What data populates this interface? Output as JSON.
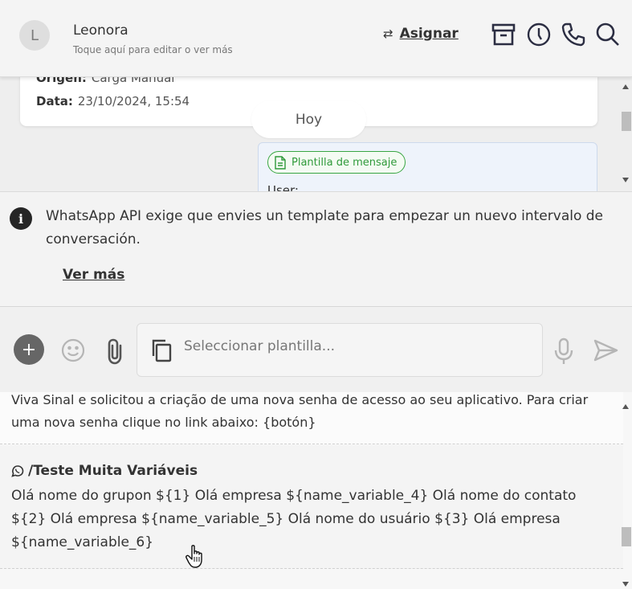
{
  "header": {
    "avatar_initial": "L",
    "contact_name": "Leonora",
    "contact_subtitle": "Toque aquí para editar o ver más",
    "assign_icon": "⇄",
    "assign_label": "Asignar",
    "icons": [
      "archive-icon",
      "clock-icon",
      "phone-icon",
      "search-icon"
    ]
  },
  "chat": {
    "origin_label": "Origen:",
    "origin_value": "Carga Manual",
    "date_label": "Data:",
    "date_value": "23/10/2024, 15:54",
    "day_separator": "Hoy",
    "template_badge": "Plantilla de mensaje",
    "message_preview": "User:"
  },
  "notice": {
    "icon": "i",
    "text": "WhatsApp API exige que envies un template para empezar un nuevo intervalo de conversación.",
    "see_more": "Ver más"
  },
  "composer": {
    "plus_label": "+",
    "placeholder": "Seleccionar plantilla...",
    "icons": [
      "plus-icon",
      "emoji-icon",
      "paperclip-icon",
      "copy-icon",
      "mic-icon",
      "send-icon"
    ]
  },
  "templates": [
    {
      "body": "Viva Sinal e solicitou a criação de uma nova senha de acesso ao seu aplicativo. Para criar uma nova senha clique no link abaixo: {botón}"
    },
    {
      "title": "/Teste Muita Variáveis",
      "body": "Olá nome do grupon ${1} Olá empresa ${name_variable_4} Olá nome do contato ${2} Olá empresa ${name_variable_5} Olá nome do usuário ${3} Olá empresa ${name_variable_6}"
    }
  ],
  "colors": {
    "template_badge_green": "#39a642",
    "icon_dark": "#2b2d42",
    "plus_button": "#666666"
  }
}
